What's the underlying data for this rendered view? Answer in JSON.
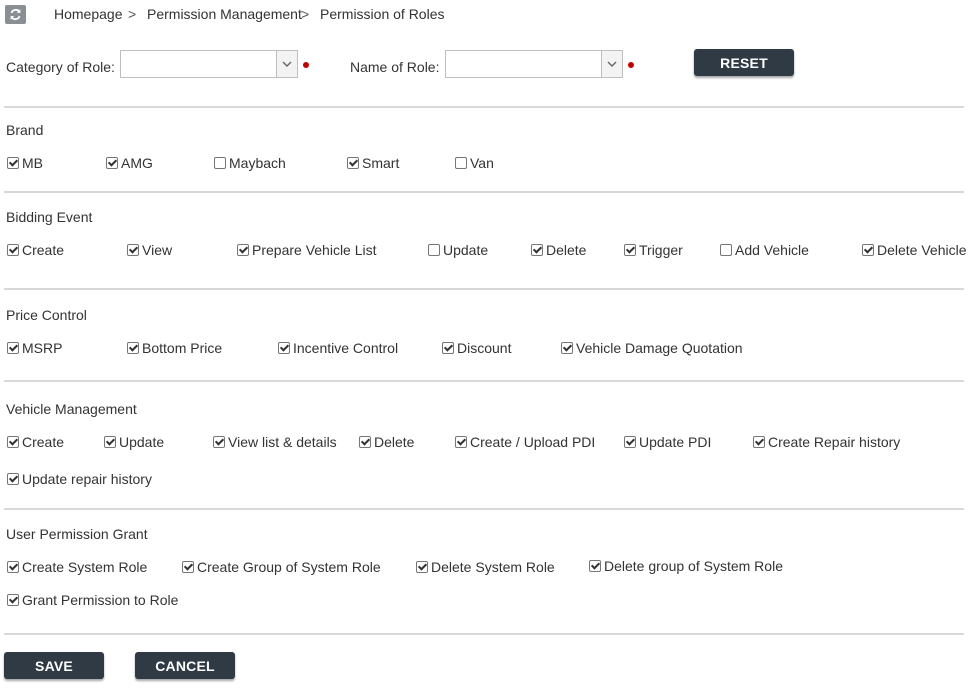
{
  "breadcrumb": [
    "Homepage",
    "Permission Management",
    "Permission of Roles"
  ],
  "breadcrumb_separator": ">",
  "form": {
    "category_label": "Category of Role:",
    "category_value": "",
    "name_label": "Name of Role:",
    "name_value": "",
    "reset_label": "RESET"
  },
  "sections": [
    {
      "title": "Brand",
      "options": [
        {
          "label": "MB",
          "checked": true
        },
        {
          "label": "AMG",
          "checked": true
        },
        {
          "label": "Maybach",
          "checked": false
        },
        {
          "label": "Smart",
          "checked": true
        },
        {
          "label": "Van",
          "checked": false
        }
      ]
    },
    {
      "title": "Bidding Event",
      "options": [
        {
          "label": "Create",
          "checked": true
        },
        {
          "label": "View",
          "checked": true
        },
        {
          "label": "Prepare Vehicle List",
          "checked": true
        },
        {
          "label": "Update",
          "checked": false
        },
        {
          "label": "Delete",
          "checked": true
        },
        {
          "label": "Trigger",
          "checked": true
        },
        {
          "label": "Add Vehicle",
          "checked": false
        },
        {
          "label": "Delete Vehicle",
          "checked": true
        }
      ]
    },
    {
      "title": "Price Control",
      "options": [
        {
          "label": "MSRP",
          "checked": true
        },
        {
          "label": "Bottom Price",
          "checked": true
        },
        {
          "label": "Incentive Control",
          "checked": true
        },
        {
          "label": "Discount",
          "checked": true
        },
        {
          "label": "Vehicle Damage Quotation",
          "checked": true
        }
      ]
    },
    {
      "title": "Vehicle Management",
      "options": [
        {
          "label": "Create",
          "checked": true
        },
        {
          "label": "Update",
          "checked": true
        },
        {
          "label": "View list & details",
          "checked": true
        },
        {
          "label": "Delete",
          "checked": true
        },
        {
          "label": "Create / Upload PDI",
          "checked": true
        },
        {
          "label": "Update PDI",
          "checked": true
        },
        {
          "label": "Create Repair history",
          "checked": true
        },
        {
          "label": "Update repair history",
          "checked": true
        }
      ]
    },
    {
      "title": "User Permission Grant",
      "options": [
        {
          "label": "Create System Role",
          "checked": true
        },
        {
          "label": "Create Group of System Role",
          "checked": true
        },
        {
          "label": "Delete System Role",
          "checked": true
        },
        {
          "label": "Delete group of System Role",
          "checked": true
        },
        {
          "label": "Grant Permission to Role",
          "checked": true
        }
      ]
    }
  ],
  "actions": {
    "save_label": "SAVE",
    "cancel_label": "CANCEL"
  },
  "colors": {
    "button_dark": "#2f3a45",
    "required_dot": "#c00000",
    "divider": "#d8d8d8"
  },
  "icons": {
    "refresh": "refresh-icon",
    "dropdown": "chevron-down-icon"
  }
}
